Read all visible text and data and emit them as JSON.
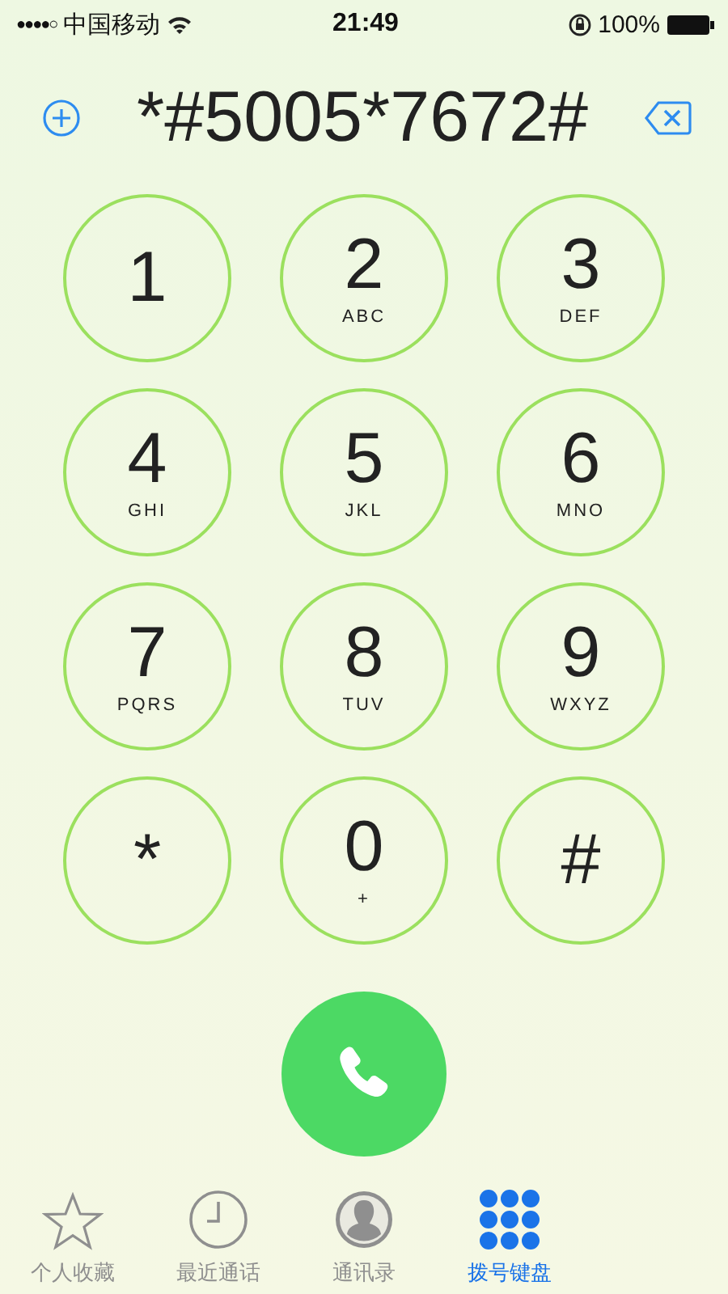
{
  "status_bar": {
    "signal_dots": "●●●●○",
    "carrier": "中国移动",
    "time": "21:49",
    "battery": "100%"
  },
  "display": {
    "number": "*#5005*7672#"
  },
  "keypad": [
    {
      "digit": "1"
    },
    {
      "digit": "2",
      "letters": "ABC"
    },
    {
      "digit": "3",
      "letters": "DEF"
    },
    {
      "digit": "4",
      "letters": "GHI"
    },
    {
      "digit": "5",
      "letters": "JKL"
    },
    {
      "digit": "6",
      "letters": "MNO"
    },
    {
      "digit": "7",
      "letters": "PQRS"
    },
    {
      "digit": "8",
      "letters": "TUV"
    },
    {
      "digit": "9",
      "letters": "WXYZ"
    },
    {
      "digit": "*"
    },
    {
      "digit": "0",
      "letters": "+"
    },
    {
      "digit": "#"
    }
  ],
  "tabs": [
    {
      "label": "个人收藏",
      "kind": "star",
      "selected": false
    },
    {
      "label": "最近通话",
      "kind": "clock",
      "selected": false
    },
    {
      "label": "通讯录",
      "kind": "person",
      "selected": false
    },
    {
      "label": "拨号键盘",
      "kind": "keypad",
      "selected": true
    }
  ]
}
